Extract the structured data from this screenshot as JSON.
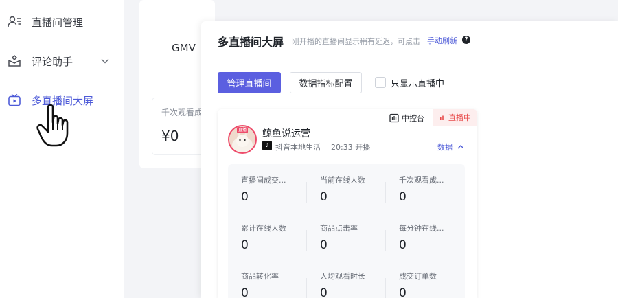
{
  "sidebar": {
    "items": [
      {
        "label": "直播间管理",
        "icon": "users-list-icon",
        "active": false
      },
      {
        "label": "评论助手",
        "icon": "comment-box-icon",
        "active": false,
        "expandable": true
      },
      {
        "label": "多直播间大屏",
        "icon": "tv-play-icon",
        "active": true
      }
    ]
  },
  "background": {
    "gmv_label": "GMV",
    "card_label": "千次观看成",
    "card_value": "¥0"
  },
  "panel": {
    "title": "多直播间大屏",
    "hint": "刚开播的直播间显示稍有延迟，可点击",
    "refresh_link": "手动刷新",
    "manage_button": "管理直播间",
    "config_button": "数据指标配置",
    "only_live_label": "只显示直播中",
    "only_live_checked": false
  },
  "room": {
    "console_tag": "中控台",
    "live_tag": "直播中",
    "avatar_badge": "直播",
    "name": "鲸鱼说运营",
    "platform": "抖音本地生活",
    "start_time": "20:33 开播",
    "data_toggle": "数据",
    "metrics": [
      {
        "label": "直播间成交...",
        "value": "0"
      },
      {
        "label": "当前在线人数",
        "value": "0"
      },
      {
        "label": "千次观看成...",
        "value": "0"
      },
      {
        "label": "累计在线人数",
        "value": "0"
      },
      {
        "label": "商品点击率",
        "value": "0"
      },
      {
        "label": "每分钟在线...",
        "value": "0"
      },
      {
        "label": "商品转化率",
        "value": "0"
      },
      {
        "label": "人均观看时长",
        "value": "0"
      },
      {
        "label": "成交订单数",
        "value": "0"
      }
    ]
  },
  "colors": {
    "accent": "#5b5fe0",
    "active_text": "#4e5bd8",
    "live": "#e84b4b"
  }
}
